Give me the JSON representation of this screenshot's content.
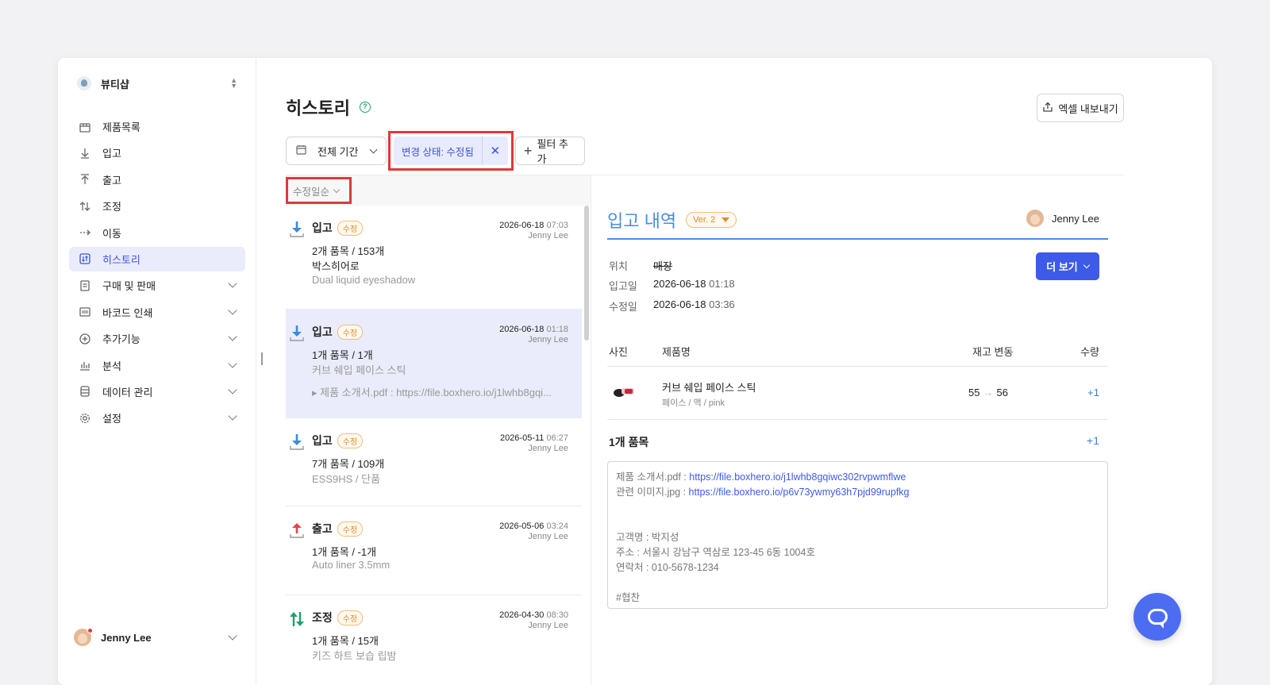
{
  "sidebar": {
    "shop_name": "뷰티샵",
    "items": [
      {
        "label": "제품목록",
        "icon": "box-icon"
      },
      {
        "label": "입고",
        "icon": "arrow-down-icon"
      },
      {
        "label": "출고",
        "icon": "arrow-up-icon"
      },
      {
        "label": "조정",
        "icon": "arrows-updown-icon"
      },
      {
        "label": "이동",
        "icon": "arrow-right-dashed-icon"
      },
      {
        "label": "히스토리",
        "icon": "history-icon",
        "active": true
      },
      {
        "label": "구매 및 판매",
        "icon": "document-icon",
        "expandable": true
      },
      {
        "label": "바코드 인쇄",
        "icon": "barcode-icon",
        "expandable": true
      },
      {
        "label": "추가기능",
        "icon": "plus-circle-icon",
        "expandable": true
      },
      {
        "label": "분석",
        "icon": "chart-icon",
        "expandable": true
      },
      {
        "label": "데이터 관리",
        "icon": "database-icon",
        "expandable": true
      },
      {
        "label": "설정",
        "icon": "gear-icon",
        "expandable": true
      }
    ],
    "user": "Jenny Lee"
  },
  "header": {
    "title": "히스토리",
    "help": "?",
    "export_label": "엑셀 내보내기"
  },
  "filters": {
    "period": "전체 기간",
    "active_chip": "변경 상태: 수정됨",
    "add_filter": "필터 추가"
  },
  "list": {
    "sort": "수정일순",
    "rows": [
      {
        "type": "입고",
        "badge": "수정",
        "date": "2026-06-18",
        "time": "07:03",
        "user": "Jenny Lee",
        "line1": "2개 품목 / 153개",
        "line2": "박스히어로",
        "line3": "Dual liquid eyeshadow"
      },
      {
        "type": "입고",
        "badge": "수정",
        "date": "2026-06-18",
        "time": "01:18",
        "user": "Jenny Lee",
        "line1": "1개 품목 / 1개",
        "line2": "커브 쉐입 페이스 스틱",
        "attachment": "▸ 제품 소개서.pdf : https://file.boxhero.io/j1lwhb8gqi..."
      },
      {
        "type": "입고",
        "badge": "수정",
        "date": "2026-05-11",
        "time": "06:27",
        "user": "Jenny Lee",
        "line1": "7개 품목 / 109개",
        "line2": "ESS9HS / 단품"
      },
      {
        "type": "출고",
        "badge": "수정",
        "date": "2026-05-06",
        "time": "03:24",
        "user": "Jenny Lee",
        "line1": "1개 품목 / -1개",
        "line2": "Auto liner 3.5mm"
      },
      {
        "type": "조정",
        "badge": "수정",
        "date": "2026-04-30",
        "time": "08:30",
        "user": "Jenny Lee",
        "line1": "1개 품목 / 15개",
        "line2": "키즈 하트 보습 립밤"
      }
    ]
  },
  "detail": {
    "title": "입고 내역",
    "version": "Ver. 2",
    "user": "Jenny Lee",
    "location_label": "위치",
    "location": "매장",
    "in_date_label": "입고일",
    "in_date": "2026-06-18",
    "in_time": "01:18",
    "mod_date_label": "수정일",
    "mod_date": "2026-06-18",
    "mod_time": "03:36",
    "more_label": "더 보기",
    "table_headers": {
      "photo": "사진",
      "name": "제품명",
      "stock": "재고 변동",
      "qty": "수량"
    },
    "product": {
      "name": "커브 쉐입 페이스 스틱",
      "options": "페이스 / 맥 / pink",
      "stock_from": "55",
      "stock_to": "56",
      "qty": "+1"
    },
    "count_label": "1개 품목",
    "count_qty": "+1",
    "memo": {
      "file1_label": "제품 소개서.pdf : ",
      "file1_link": "https://file.boxhero.io/j1lwhb8gqiwc302rvpwmflwe",
      "file2_label": "관련 이미지.jpg : ",
      "file2_link": "https://file.boxhero.io/p6v73ywmy63h7pjd99rupfkg",
      "customer": "고객명 : 박지성",
      "address": "주소 : 서울시 강남구 역삼로 123-45 6동 1004호",
      "contact": "연락처 : 010-5678-1234",
      "tag": "#협찬"
    }
  },
  "colors": {
    "accent": "#3d5ae8",
    "highlight_box": "#e0383a",
    "badge": "#e0892b",
    "in_arrow": "#3d8be0",
    "out_arrow": "#e04848",
    "adjust_arrow": "#22a06b"
  }
}
